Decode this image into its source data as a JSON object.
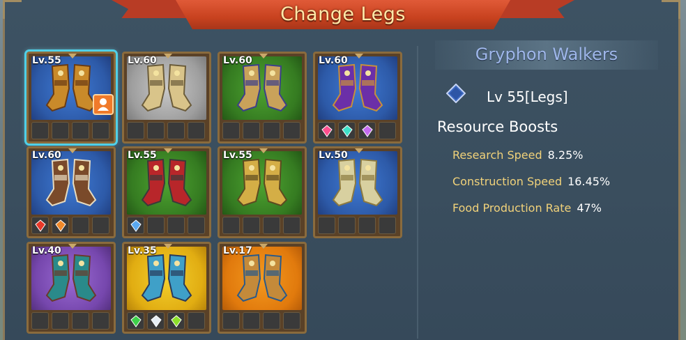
{
  "header": {
    "title": "Change Legs"
  },
  "items": [
    {
      "level": "Lv.55",
      "bg": "blue",
      "icon": "gryphon-boots-icon",
      "selected": true,
      "equipped": true,
      "gems": [
        "empty",
        "empty",
        "empty",
        "empty"
      ]
    },
    {
      "level": "Lv.60",
      "bg": "gray",
      "icon": "armored-greaves-icon",
      "gems": [
        "empty",
        "empty",
        "empty",
        "empty"
      ]
    },
    {
      "level": "Lv.60",
      "bg": "green",
      "icon": "spiked-legs-icon",
      "gems": [
        "empty",
        "empty",
        "empty",
        "empty"
      ]
    },
    {
      "level": "Lv.60",
      "bg": "blue",
      "icon": "purple-demon-legs-icon",
      "gems": [
        "pink-gem",
        "teal-gem",
        "purple-gem",
        "empty"
      ]
    },
    {
      "level": "Lv.60",
      "bg": "blue",
      "icon": "beast-skull-legs-icon",
      "gems": [
        "red-gem",
        "orange-gem",
        "empty",
        "empty"
      ]
    },
    {
      "level": "Lv.55",
      "bg": "green",
      "icon": "red-plate-legs-icon",
      "gems": [
        "blue-gem",
        "empty",
        "empty",
        "empty"
      ]
    },
    {
      "level": "Lv.55",
      "bg": "green",
      "icon": "gold-beast-legs-icon",
      "gems": [
        "empty",
        "empty",
        "empty",
        "empty"
      ]
    },
    {
      "level": "Lv.50",
      "bg": "blue",
      "icon": "stone-boots-icon",
      "gems": [
        "empty",
        "empty",
        "empty",
        "empty"
      ]
    },
    {
      "level": "Lv.40",
      "bg": "purple",
      "icon": "teal-rune-legs-icon",
      "gems": [
        "empty",
        "empty",
        "empty",
        "empty"
      ]
    },
    {
      "level": "Lv.35",
      "bg": "yellow",
      "icon": "silver-boots-icon",
      "gems": [
        "green-gem",
        "white-gem",
        "lime-gem",
        "empty"
      ]
    },
    {
      "level": "Lv.17",
      "bg": "orange",
      "icon": "bronze-boots-icon",
      "gems": [
        "empty",
        "empty",
        "empty",
        "empty"
      ]
    }
  ],
  "detail": {
    "name": "Gryphon Walkers",
    "level_text": "Lv 55[Legs]",
    "boost_heading": "Resource Boosts",
    "boosts": [
      {
        "name": "Research Speed",
        "value": "8.25%"
      },
      {
        "name": "Construction Speed",
        "value": "16.45%"
      },
      {
        "name": "Food Production Rate",
        "value": "47%"
      }
    ]
  },
  "colors": {
    "accent_title": "#9fb7ea",
    "stat_name": "#f1d27a",
    "ribbon": "#c8421f"
  }
}
